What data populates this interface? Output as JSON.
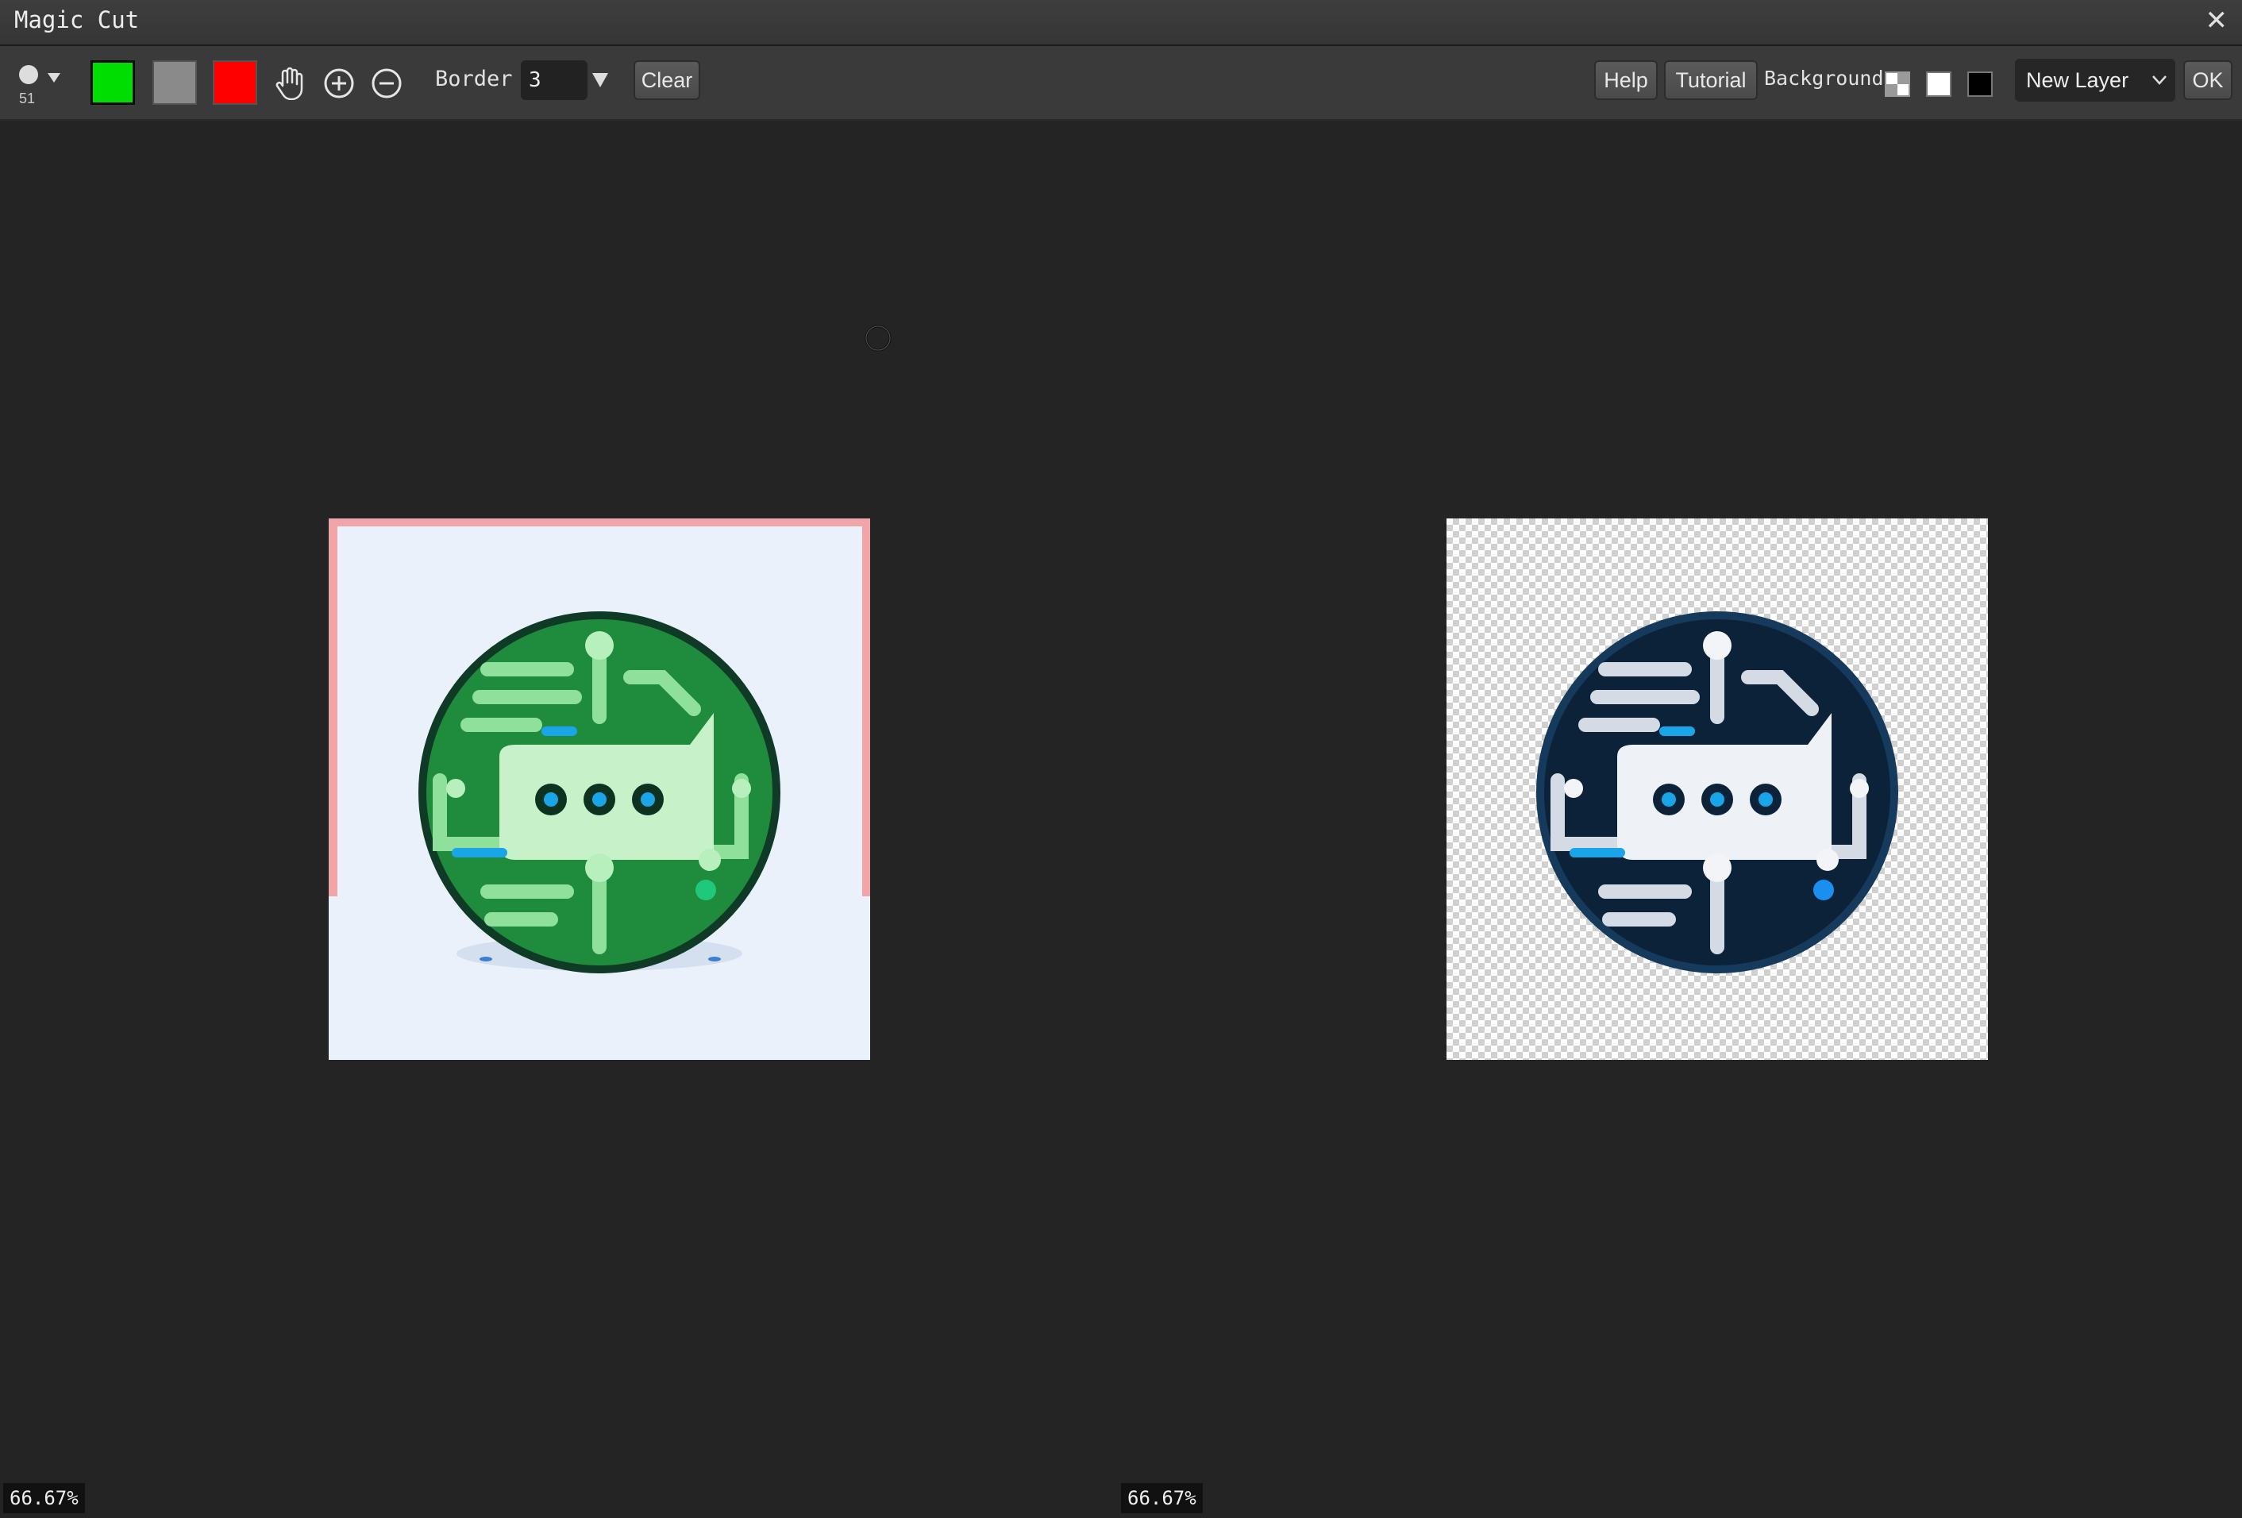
{
  "window": {
    "title": "Magic Cut",
    "close_icon": "close-icon"
  },
  "toolbar": {
    "brush_size": "51",
    "colors": {
      "keep": "#00dd00",
      "neutral": "#8a8a8a",
      "remove": "#ff0000"
    },
    "border_label": "Border",
    "border_value": "3",
    "clear_label": "Clear",
    "help_label": "Help",
    "tutorial_label": "Tutorial",
    "background_label": "Background:",
    "layer_select": {
      "selected": "New Layer"
    },
    "ok_label": "OK"
  },
  "status": {
    "left_zoom": "66.67%",
    "right_zoom": "66.67%"
  }
}
